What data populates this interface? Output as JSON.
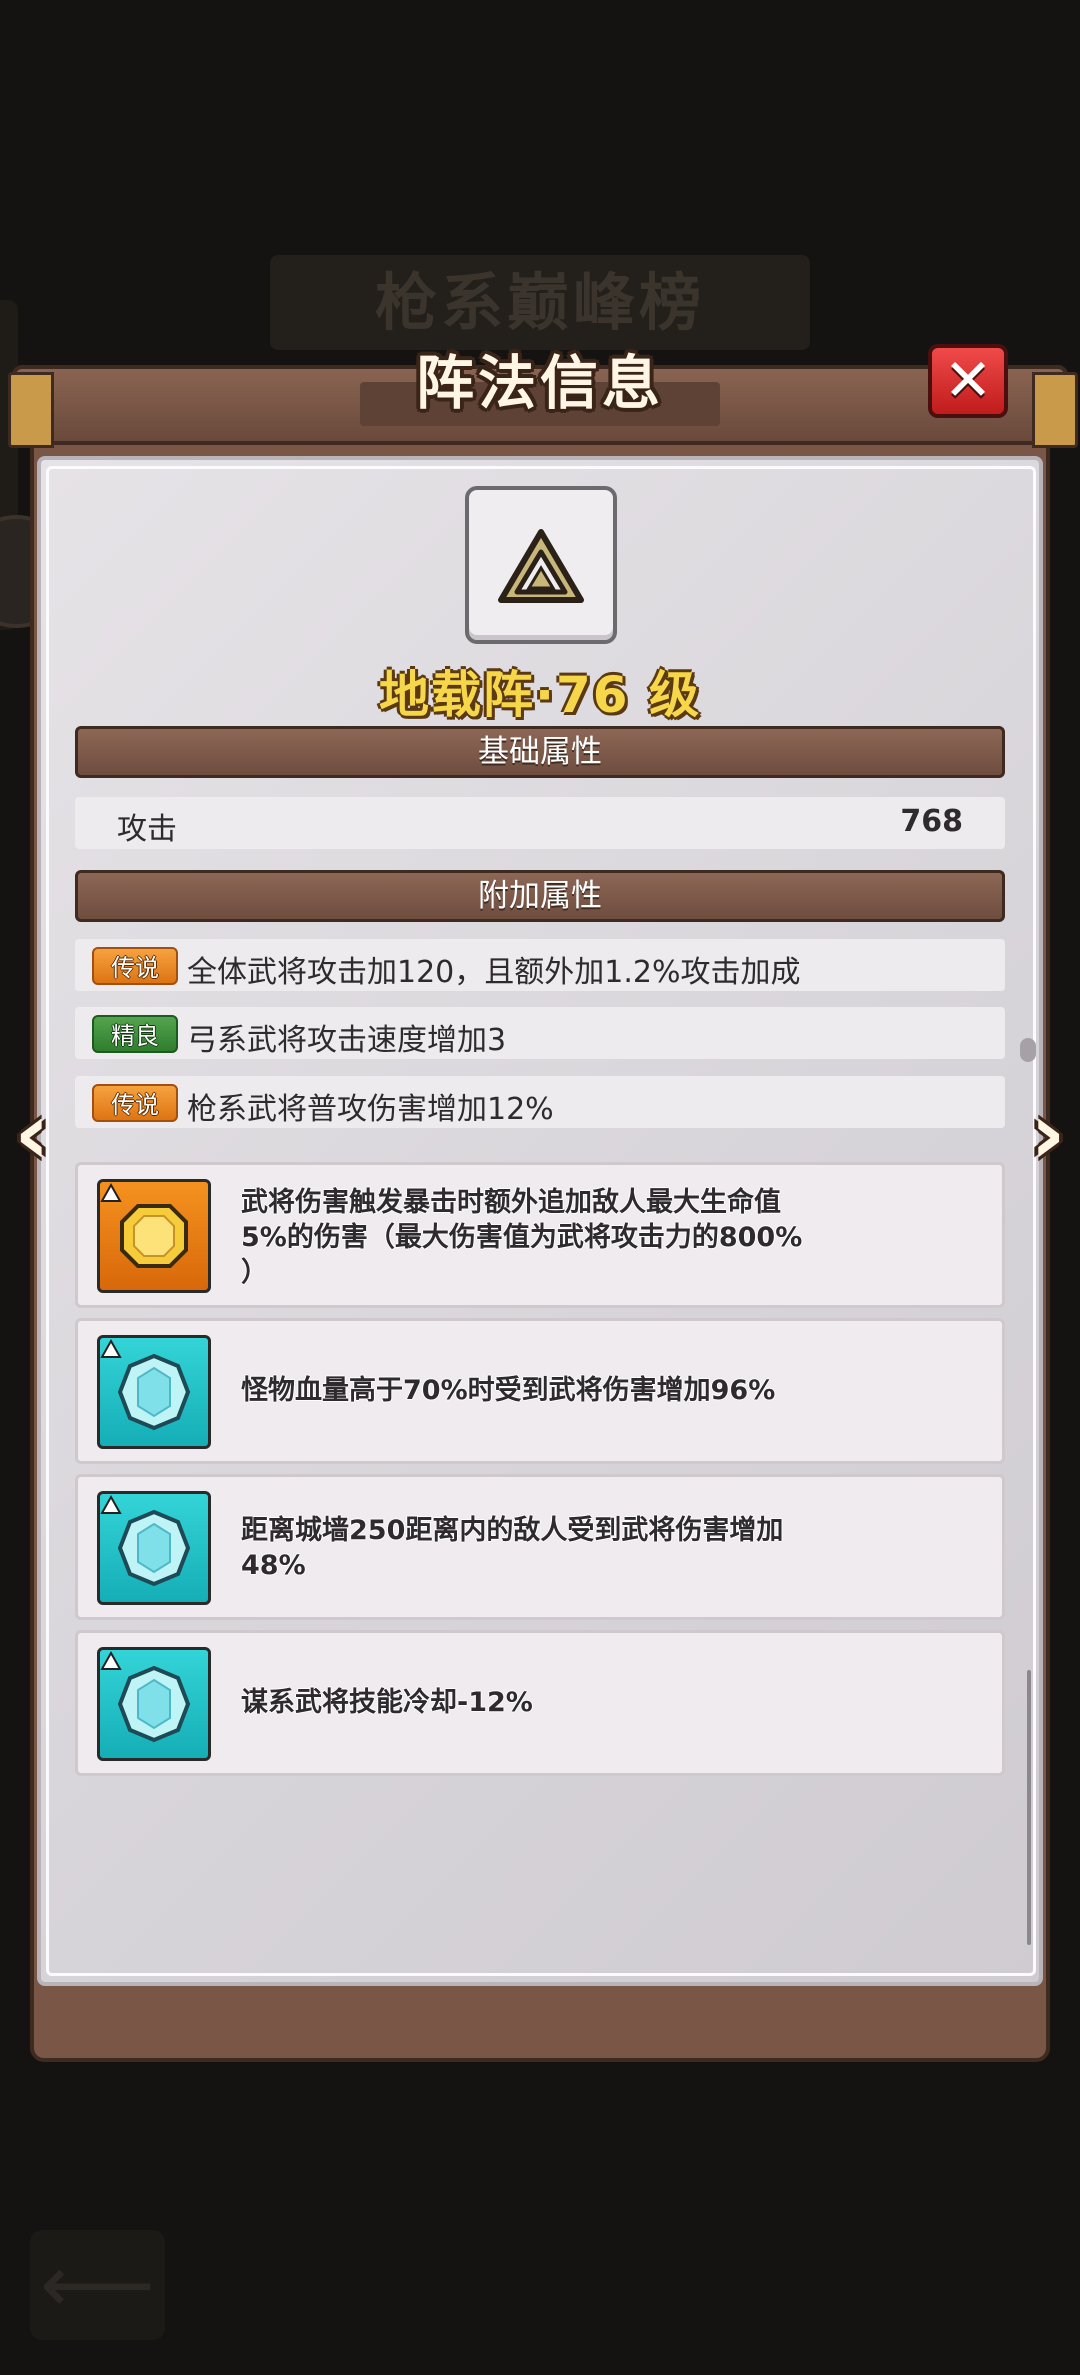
{
  "background": {
    "banner_title": "枪系巅峰榜",
    "back_icon": "arrow-left-icon"
  },
  "modal": {
    "title": "阵法信息",
    "close_icon": "close-icon"
  },
  "formation": {
    "icon": "triangle-formation-icon",
    "name_level": "地载阵·76 级"
  },
  "basic_section": {
    "header": "基础属性",
    "stats": [
      {
        "name": "攻击",
        "value": "768"
      }
    ]
  },
  "extra_section": {
    "header": "附加属性",
    "rows": [
      {
        "badge": "传说",
        "badge_color": "#e8831f",
        "text": "全体武将攻击加120，且额外加1.2%攻击加成"
      },
      {
        "badge": "精良",
        "badge_color": "#3a8c38",
        "text": "弓系武将攻击速度增加3"
      },
      {
        "badge": "传说",
        "badge_color": "#e8831f",
        "text": "枪系武将普攻伤害增加12%"
      }
    ]
  },
  "gem_effects": [
    {
      "gem": "topaz-gem-icon",
      "color": "#e57f14",
      "line1": "武将伤害触发暴击时额外追加敌人最大生命值",
      "line2": "5%的伤害（最大伤害值为武将攻击力的800%",
      "line3": "）"
    },
    {
      "gem": "diamond-gem-icon",
      "color": "#22c2c8",
      "line1": "怪物血量高于70%时受到武将伤害增加96%",
      "line2": "",
      "line3": ""
    },
    {
      "gem": "diamond-gem-icon",
      "color": "#22c2c8",
      "line1": "距离城墙250距离内的敌人受到武将伤害增加",
      "line2": "48%",
      "line3": ""
    },
    {
      "gem": "diamond-gem-icon",
      "color": "#22c2c8",
      "line1": "谋系武将技能冷却-12%",
      "line2": "",
      "line3": ""
    }
  ],
  "nav": {
    "prev_icon": "chevron-left-icon",
    "next_icon": "chevron-right-icon"
  }
}
